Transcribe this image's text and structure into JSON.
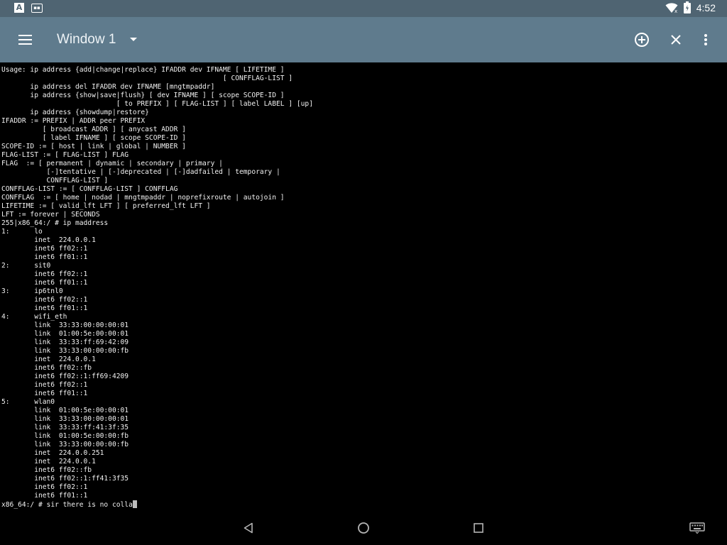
{
  "status_bar": {
    "left_icons": [
      "a-notification-icon",
      "sim-notification-icon"
    ],
    "a_icon_glyph": "A",
    "right_icons": [
      "wifi-icon",
      "battery-icon"
    ],
    "time": "4:52"
  },
  "toolbar": {
    "title": "Window 1",
    "icons": [
      "menu-icon",
      "dropdown-caret-icon",
      "add-window-icon",
      "close-window-icon",
      "overflow-menu-icon"
    ],
    "color": "#5f7b8d"
  },
  "terminal": {
    "lines": [
      "Usage: ip address {add|change|replace} IFADDR dev IFNAME [ LIFETIME ]",
      "                                                      [ CONFFLAG-LIST ]",
      "       ip address del IFADDR dev IFNAME [mngtmpaddr]",
      "       ip address {show|save|flush} [ dev IFNAME ] [ scope SCOPE-ID ]",
      "                            [ to PREFIX ] [ FLAG-LIST ] [ label LABEL ] [up]",
      "       ip address {showdump|restore}",
      "IFADDR := PREFIX | ADDR peer PREFIX",
      "          [ broadcast ADDR ] [ anycast ADDR ]",
      "          [ label IFNAME ] [ scope SCOPE-ID ]",
      "SCOPE-ID := [ host | link | global | NUMBER ]",
      "FLAG-LIST := [ FLAG-LIST ] FLAG",
      "FLAG  := [ permanent | dynamic | secondary | primary |",
      "           [-]tentative | [-]deprecated | [-]dadfailed | temporary |",
      "           CONFFLAG-LIST ]",
      "CONFFLAG-LIST := [ CONFFLAG-LIST ] CONFFLAG",
      "CONFFLAG  := [ home | nodad | mngtmpaddr | noprefixroute | autojoin ]",
      "LIFETIME := [ valid_lft LFT ] [ preferred_lft LFT ]",
      "LFT := forever | SECONDS",
      "255|x86_64:/ # ip maddress",
      "1:      lo",
      "        inet  224.0.0.1",
      "        inet6 ff02::1",
      "        inet6 ff01::1",
      "2:      sit0",
      "        inet6 ff02::1",
      "        inet6 ff01::1",
      "3:      ip6tnl0",
      "        inet6 ff02::1",
      "        inet6 ff01::1",
      "4:      wifi_eth",
      "        link  33:33:00:00:00:01",
      "        link  01:00:5e:00:00:01",
      "        link  33:33:ff:69:42:09",
      "        link  33:33:00:00:00:fb",
      "        inet  224.0.0.1",
      "        inet6 ff02::fb",
      "        inet6 ff02::1:ff69:4209",
      "        inet6 ff02::1",
      "        inet6 ff01::1",
      "5:      wlan0",
      "        link  01:00:5e:00:00:01",
      "        link  33:33:00:00:00:01",
      "        link  33:33:ff:41:3f:35",
      "        link  01:00:5e:00:00:fb",
      "        link  33:33:00:00:00:fb",
      "        inet  224.0.0.251",
      "        inet  224.0.0.1",
      "        inet6 ff02::fb",
      "        inet6 ff02::1:ff41:3f35",
      "        inet6 ff02::1",
      "        inet6 ff01::1"
    ],
    "prompt": "x86_64:/ # ",
    "input": "sir there is no colla"
  },
  "nav_bar": {
    "icons": [
      "back-icon",
      "home-icon",
      "recents-icon",
      "keyboard-icon"
    ]
  }
}
